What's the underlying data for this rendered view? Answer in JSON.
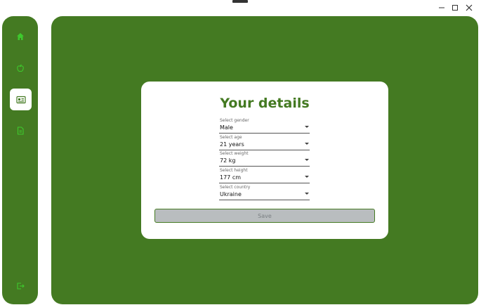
{
  "window": {
    "controls": {
      "minimize": "minimize-icon",
      "maximize": "maximize-icon",
      "close": "close-icon"
    }
  },
  "sidebar": {
    "items": [
      {
        "id": "home",
        "icon": "home-icon"
      },
      {
        "id": "nutrition",
        "icon": "apple-icon"
      },
      {
        "id": "details",
        "icon": "id-card-icon",
        "active": true
      },
      {
        "id": "report",
        "icon": "file-icon"
      }
    ],
    "logout_icon": "logout-icon",
    "accent": "#447a22"
  },
  "card": {
    "title": "Your details",
    "fields": [
      {
        "label": "Select gender",
        "value": "Male"
      },
      {
        "label": "Select age",
        "value": "21 years"
      },
      {
        "label": "Select weight",
        "value": "72 kg"
      },
      {
        "label": "Select height",
        "value": "177 cm"
      },
      {
        "label": "Select country",
        "value": "Ukraine"
      }
    ],
    "save_label": "Save"
  },
  "colors": {
    "background": "#447a22",
    "card": "#ffffff",
    "button_disabled": "#b9bdbf",
    "icon_green": "#3ec92d"
  }
}
